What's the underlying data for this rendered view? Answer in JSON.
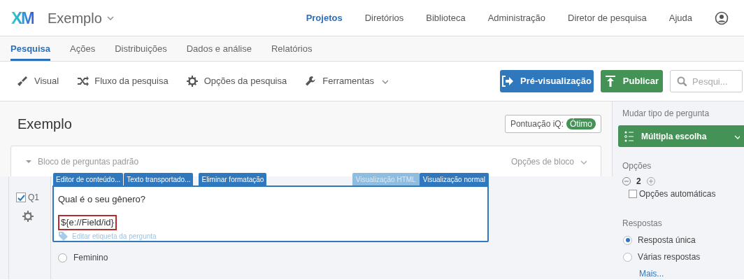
{
  "header": {
    "logo": "XM",
    "project": "Exemplo",
    "nav": [
      {
        "label": "Projetos",
        "selected": true
      },
      {
        "label": "Diretórios",
        "selected": false
      },
      {
        "label": "Biblioteca",
        "selected": false
      },
      {
        "label": "Administração",
        "selected": false
      },
      {
        "label": "Diretor de pesquisa",
        "selected": false
      },
      {
        "label": "Ajuda",
        "selected": false
      }
    ]
  },
  "tabs": [
    {
      "label": "Pesquisa",
      "selected": true
    },
    {
      "label": "Ações",
      "selected": false
    },
    {
      "label": "Distribuições",
      "selected": false
    },
    {
      "label": "Dados e análise",
      "selected": false
    },
    {
      "label": "Relatórios",
      "selected": false
    }
  ],
  "toolbar": {
    "items": [
      {
        "label": "Visual",
        "kind": "brush",
        "dropdown": false
      },
      {
        "label": "Fluxo da pesquisa",
        "kind": "flow",
        "dropdown": false
      },
      {
        "label": "Opções da pesquisa",
        "kind": "gear",
        "dropdown": false
      },
      {
        "label": "Ferramentas",
        "kind": "wrench",
        "dropdown": true
      }
    ],
    "preview": "Pré-visualização",
    "publish": "Publicar",
    "search": {
      "placeholder": "Pesqui..."
    }
  },
  "survey": {
    "title": "Exemplo",
    "iq_label": "Pontuação iQ:",
    "iq_badge": "Ótimo",
    "block": {
      "title": "Bloco de perguntas padrão",
      "options": "Opções de bloco"
    },
    "question": {
      "number": "Q1",
      "checked": true,
      "choices": [
        {
          "label": "Feminino",
          "selected": false
        }
      ],
      "editor": {
        "left_tabs": [
          "Editor de conteúdo...",
          "Texto transportado...",
          "Eliminar formatação"
        ],
        "view_tabs": [
          {
            "label": "Visualização HTML",
            "selected": false
          },
          {
            "label": "Visualização normal",
            "selected": true
          }
        ],
        "text": "Qual é o seu gênero?",
        "piped_text": "${e://Field/id}",
        "tag_hint": "Editar etiqueta da pergunta"
      }
    }
  },
  "panel": {
    "change_type_label": "Mudar tipo de pergunta",
    "type": "Múltipla escolha",
    "options_label": "Opções",
    "count": "2",
    "auto_choices": {
      "label": "Opções automáticas",
      "checked": false
    },
    "answers_label": "Respostas",
    "answers": [
      {
        "label": "Resposta única",
        "selected": true
      },
      {
        "label": "Várias respostas",
        "selected": false
      }
    ],
    "more": "Mais..."
  }
}
